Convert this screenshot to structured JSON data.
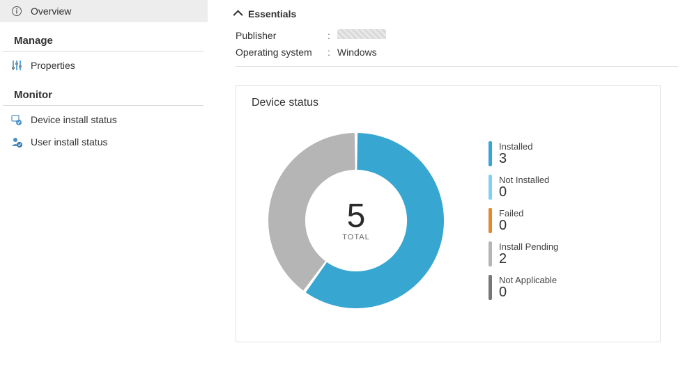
{
  "sidebar": {
    "items": [
      {
        "label": "Overview"
      },
      {
        "label": "Properties"
      },
      {
        "label": "Device install status"
      },
      {
        "label": "User install status"
      }
    ],
    "sections": {
      "manage": "Manage",
      "monitor": "Monitor"
    }
  },
  "essentials": {
    "header": "Essentials",
    "publisher_label": "Publisher",
    "publisher_value": "",
    "os_label": "Operating system",
    "os_value": "Windows"
  },
  "card": {
    "title": "Device status",
    "total": 5,
    "total_label": "TOTAL"
  },
  "legend": [
    {
      "name": "Installed",
      "value": 3,
      "color": "#37a6d1"
    },
    {
      "name": "Not Installed",
      "value": 0,
      "color": "#7ed2ee"
    },
    {
      "name": "Failed",
      "value": 0,
      "color": "#e08a2d"
    },
    {
      "name": "Install Pending",
      "value": 2,
      "color": "#b5b5b5"
    },
    {
      "name": "Not Applicable",
      "value": 0,
      "color": "#777777"
    }
  ],
  "chart_data": {
    "type": "pie",
    "title": "Device status",
    "categories": [
      "Installed",
      "Not Installed",
      "Failed",
      "Install Pending",
      "Not Applicable"
    ],
    "values": [
      3,
      0,
      0,
      2,
      0
    ],
    "colors": [
      "#37a6d1",
      "#7ed2ee",
      "#e08a2d",
      "#b5b5b5",
      "#777777"
    ],
    "total": 5,
    "total_label": "TOTAL",
    "donut_inner_ratio": 0.58
  }
}
